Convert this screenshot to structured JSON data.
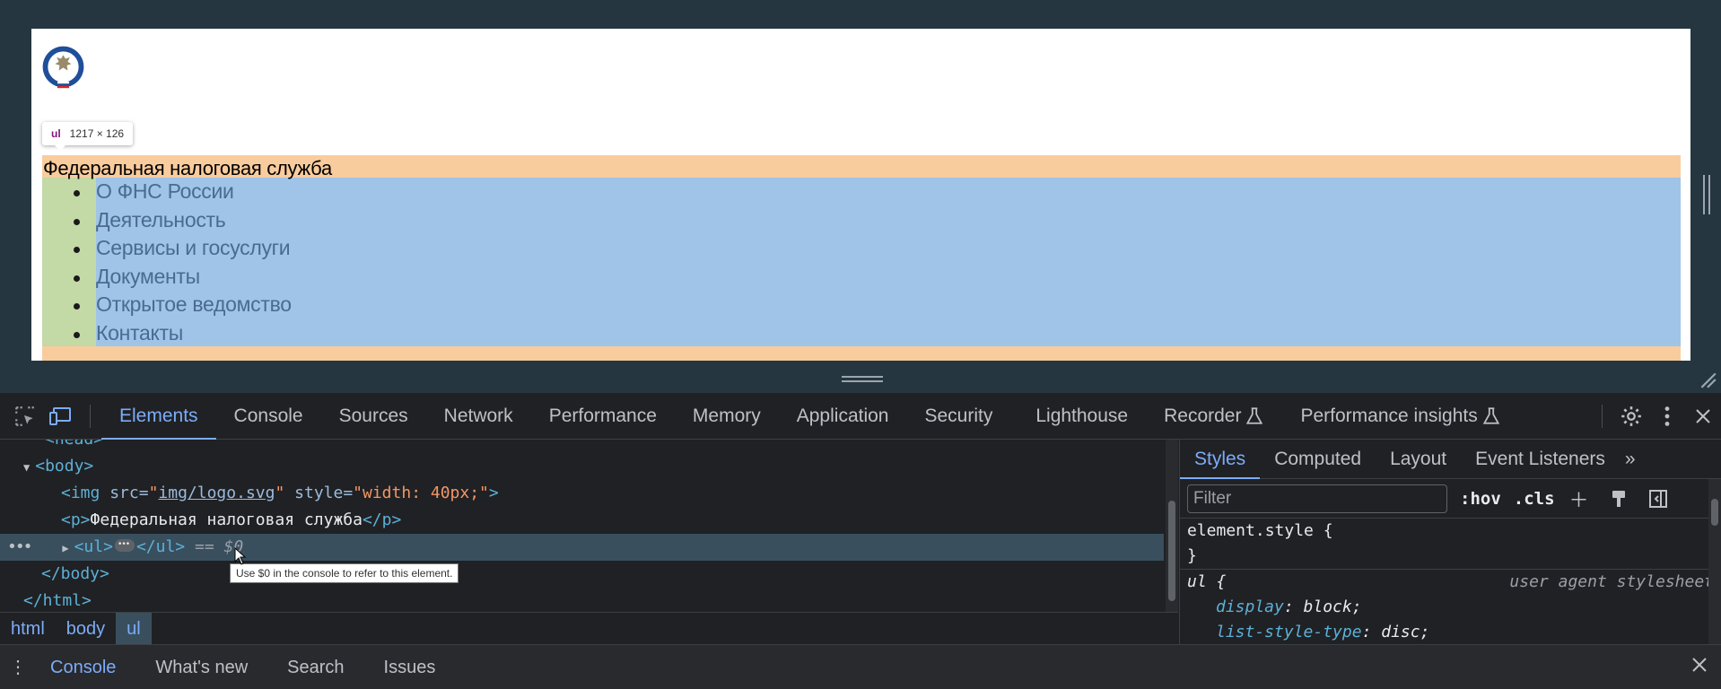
{
  "page": {
    "title": "Федеральная налоговая служба",
    "nav": [
      "О ФНС России",
      "Деятельность",
      "Сервисы и госуслуги",
      "Документы",
      "Открытое ведомство",
      "Контакты"
    ],
    "inspect_tooltip": {
      "tag": "ul",
      "size": "1217 × 126"
    }
  },
  "toolbar": {
    "tabs": [
      "Elements",
      "Console",
      "Sources",
      "Network",
      "Performance",
      "Memory",
      "Application",
      "Security",
      "Lighthouse",
      "Recorder",
      "Performance insights"
    ],
    "active_tab": "Elements"
  },
  "dom": {
    "head_partial": "<head>",
    "body_open": "<body>",
    "img_tag": "<img",
    "img_src_attr": "src=",
    "img_src_value": "img/logo.svg",
    "img_style_attr": "style=",
    "img_style_value": "\"width: 40px;\"",
    "img_close": ">",
    "p_open": "<p>",
    "p_text": "Федеральная налоговая служба",
    "p_close": "</p>",
    "ul_open": "<ul>",
    "ul_close": "</ul>",
    "selected_marker": "== $0",
    "body_close": "</body>",
    "html_close": "</html>",
    "tooltip": "Use $0 in the console to refer to this element."
  },
  "breadcrumb": [
    "html",
    "body",
    "ul"
  ],
  "styles": {
    "tabs": [
      "Styles",
      "Computed",
      "Layout",
      "Event Listeners"
    ],
    "filter_placeholder": "Filter",
    "hov": ":hov",
    "cls": ".cls",
    "element_style": "element.style {",
    "close_brace": "}",
    "ul_selector": "ul {",
    "ua_source": "user agent stylesheet",
    "props": [
      {
        "name": "display",
        "value": "block;"
      },
      {
        "name": "list-style-type",
        "value": "disc;"
      }
    ]
  },
  "drawer": {
    "tabs": [
      "Console",
      "What's new",
      "Search",
      "Issues"
    ]
  }
}
